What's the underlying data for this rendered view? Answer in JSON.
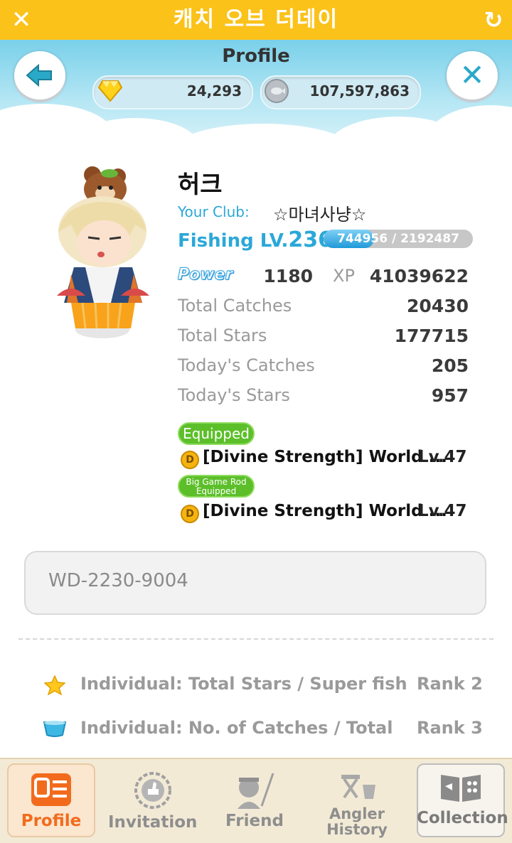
{
  "app": {
    "title": "캐치 오브 더데이"
  },
  "header": {
    "title": "Profile",
    "gems": "24,293",
    "coins": "107,597,863"
  },
  "profile": {
    "name": "허크",
    "club_label": "Your Club:",
    "club_name": "☆마녀사냥☆",
    "fishing_label": "Fishing LV.",
    "fishing_level": "236",
    "xp_text": "744956 / 2192487",
    "xp_progress": 0.34,
    "power_label": "Power",
    "power": "1180",
    "xp_label": "XP",
    "xp": "41039622",
    "stats": [
      {
        "label": "Total  Catches",
        "value": "20430"
      },
      {
        "label": "Total Stars",
        "value": "177715"
      },
      {
        "label": "Today's Catches",
        "value": "205"
      },
      {
        "label": "Today's Stars",
        "value": "957"
      }
    ]
  },
  "equipment": {
    "equipped_badge": "Equipped",
    "bigrod_badge_line1": "Big Game Rod",
    "bigrod_badge_line2": "Equipped",
    "coin_letter": "D",
    "items": [
      {
        "name": "[Divine Strength] World ...",
        "level": "Lv.47"
      },
      {
        "name": "[Divine Strength] World ...",
        "level": "Lv.47"
      }
    ]
  },
  "code": "WD-2230-9004",
  "rankings": [
    {
      "icon": "star-icon",
      "label": "Individual: Total Stars / Super fish",
      "rank": "Rank 2"
    },
    {
      "icon": "bucket-icon",
      "label": "Individual: No. of Catches / Total",
      "rank": "Rank 3"
    }
  ],
  "tabs": [
    {
      "label": "Profile",
      "active": true
    },
    {
      "label": "Invitation"
    },
    {
      "label": "Friend"
    },
    {
      "label_line1": "Angler",
      "label_line2": "History"
    },
    {
      "label": "Collection"
    }
  ],
  "colors": {
    "accent": "#fbc21a",
    "level_blue": "#2aa8d8",
    "badge_green": "#5cbf2a",
    "tab_active": "#f26b1d"
  }
}
